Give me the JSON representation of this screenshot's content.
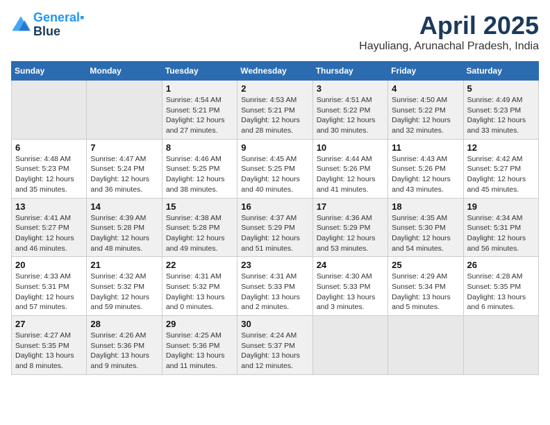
{
  "header": {
    "logo_line1": "General",
    "logo_line2": "Blue",
    "month": "April 2025",
    "location": "Hayuliang, Arunachal Pradesh, India"
  },
  "days_of_week": [
    "Sunday",
    "Monday",
    "Tuesday",
    "Wednesday",
    "Thursday",
    "Friday",
    "Saturday"
  ],
  "weeks": [
    [
      {
        "day": null
      },
      {
        "day": null
      },
      {
        "day": "1",
        "sunrise": "Sunrise: 4:54 AM",
        "sunset": "Sunset: 5:21 PM",
        "daylight": "Daylight: 12 hours and 27 minutes."
      },
      {
        "day": "2",
        "sunrise": "Sunrise: 4:53 AM",
        "sunset": "Sunset: 5:21 PM",
        "daylight": "Daylight: 12 hours and 28 minutes."
      },
      {
        "day": "3",
        "sunrise": "Sunrise: 4:51 AM",
        "sunset": "Sunset: 5:22 PM",
        "daylight": "Daylight: 12 hours and 30 minutes."
      },
      {
        "day": "4",
        "sunrise": "Sunrise: 4:50 AM",
        "sunset": "Sunset: 5:22 PM",
        "daylight": "Daylight: 12 hours and 32 minutes."
      },
      {
        "day": "5",
        "sunrise": "Sunrise: 4:49 AM",
        "sunset": "Sunset: 5:23 PM",
        "daylight": "Daylight: 12 hours and 33 minutes."
      }
    ],
    [
      {
        "day": "6",
        "sunrise": "Sunrise: 4:48 AM",
        "sunset": "Sunset: 5:23 PM",
        "daylight": "Daylight: 12 hours and 35 minutes."
      },
      {
        "day": "7",
        "sunrise": "Sunrise: 4:47 AM",
        "sunset": "Sunset: 5:24 PM",
        "daylight": "Daylight: 12 hours and 36 minutes."
      },
      {
        "day": "8",
        "sunrise": "Sunrise: 4:46 AM",
        "sunset": "Sunset: 5:25 PM",
        "daylight": "Daylight: 12 hours and 38 minutes."
      },
      {
        "day": "9",
        "sunrise": "Sunrise: 4:45 AM",
        "sunset": "Sunset: 5:25 PM",
        "daylight": "Daylight: 12 hours and 40 minutes."
      },
      {
        "day": "10",
        "sunrise": "Sunrise: 4:44 AM",
        "sunset": "Sunset: 5:26 PM",
        "daylight": "Daylight: 12 hours and 41 minutes."
      },
      {
        "day": "11",
        "sunrise": "Sunrise: 4:43 AM",
        "sunset": "Sunset: 5:26 PM",
        "daylight": "Daylight: 12 hours and 43 minutes."
      },
      {
        "day": "12",
        "sunrise": "Sunrise: 4:42 AM",
        "sunset": "Sunset: 5:27 PM",
        "daylight": "Daylight: 12 hours and 45 minutes."
      }
    ],
    [
      {
        "day": "13",
        "sunrise": "Sunrise: 4:41 AM",
        "sunset": "Sunset: 5:27 PM",
        "daylight": "Daylight: 12 hours and 46 minutes."
      },
      {
        "day": "14",
        "sunrise": "Sunrise: 4:39 AM",
        "sunset": "Sunset: 5:28 PM",
        "daylight": "Daylight: 12 hours and 48 minutes."
      },
      {
        "day": "15",
        "sunrise": "Sunrise: 4:38 AM",
        "sunset": "Sunset: 5:28 PM",
        "daylight": "Daylight: 12 hours and 49 minutes."
      },
      {
        "day": "16",
        "sunrise": "Sunrise: 4:37 AM",
        "sunset": "Sunset: 5:29 PM",
        "daylight": "Daylight: 12 hours and 51 minutes."
      },
      {
        "day": "17",
        "sunrise": "Sunrise: 4:36 AM",
        "sunset": "Sunset: 5:29 PM",
        "daylight": "Daylight: 12 hours and 53 minutes."
      },
      {
        "day": "18",
        "sunrise": "Sunrise: 4:35 AM",
        "sunset": "Sunset: 5:30 PM",
        "daylight": "Daylight: 12 hours and 54 minutes."
      },
      {
        "day": "19",
        "sunrise": "Sunrise: 4:34 AM",
        "sunset": "Sunset: 5:31 PM",
        "daylight": "Daylight: 12 hours and 56 minutes."
      }
    ],
    [
      {
        "day": "20",
        "sunrise": "Sunrise: 4:33 AM",
        "sunset": "Sunset: 5:31 PM",
        "daylight": "Daylight: 12 hours and 57 minutes."
      },
      {
        "day": "21",
        "sunrise": "Sunrise: 4:32 AM",
        "sunset": "Sunset: 5:32 PM",
        "daylight": "Daylight: 12 hours and 59 minutes."
      },
      {
        "day": "22",
        "sunrise": "Sunrise: 4:31 AM",
        "sunset": "Sunset: 5:32 PM",
        "daylight": "Daylight: 13 hours and 0 minutes."
      },
      {
        "day": "23",
        "sunrise": "Sunrise: 4:31 AM",
        "sunset": "Sunset: 5:33 PM",
        "daylight": "Daylight: 13 hours and 2 minutes."
      },
      {
        "day": "24",
        "sunrise": "Sunrise: 4:30 AM",
        "sunset": "Sunset: 5:33 PM",
        "daylight": "Daylight: 13 hours and 3 minutes."
      },
      {
        "day": "25",
        "sunrise": "Sunrise: 4:29 AM",
        "sunset": "Sunset: 5:34 PM",
        "daylight": "Daylight: 13 hours and 5 minutes."
      },
      {
        "day": "26",
        "sunrise": "Sunrise: 4:28 AM",
        "sunset": "Sunset: 5:35 PM",
        "daylight": "Daylight: 13 hours and 6 minutes."
      }
    ],
    [
      {
        "day": "27",
        "sunrise": "Sunrise: 4:27 AM",
        "sunset": "Sunset: 5:35 PM",
        "daylight": "Daylight: 13 hours and 8 minutes."
      },
      {
        "day": "28",
        "sunrise": "Sunrise: 4:26 AM",
        "sunset": "Sunset: 5:36 PM",
        "daylight": "Daylight: 13 hours and 9 minutes."
      },
      {
        "day": "29",
        "sunrise": "Sunrise: 4:25 AM",
        "sunset": "Sunset: 5:36 PM",
        "daylight": "Daylight: 13 hours and 11 minutes."
      },
      {
        "day": "30",
        "sunrise": "Sunrise: 4:24 AM",
        "sunset": "Sunset: 5:37 PM",
        "daylight": "Daylight: 13 hours and 12 minutes."
      },
      {
        "day": null
      },
      {
        "day": null
      },
      {
        "day": null
      }
    ]
  ]
}
